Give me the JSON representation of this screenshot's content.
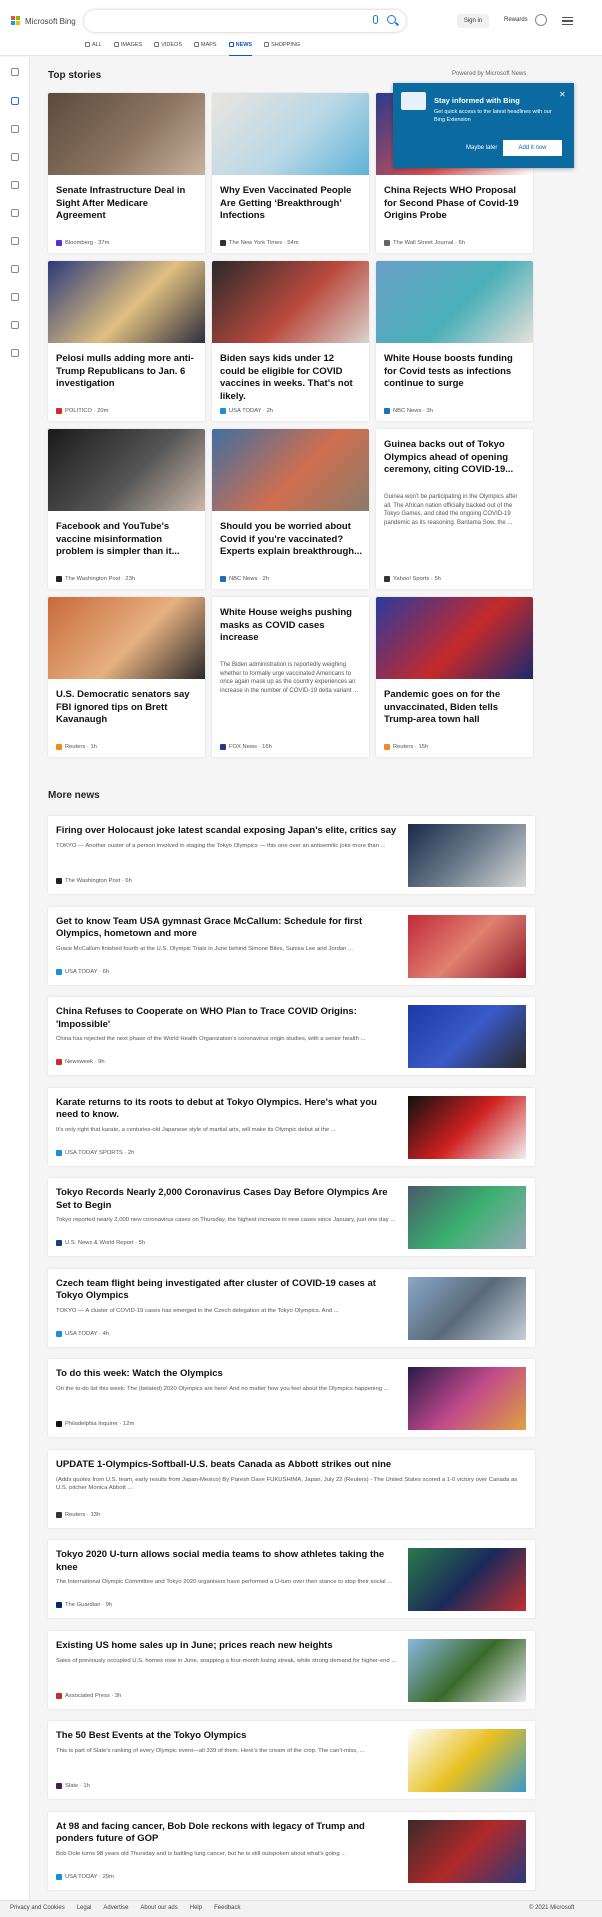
{
  "header": {
    "logo": "Microsoft Bing",
    "signin": "Sign in",
    "rewards": "Rewards"
  },
  "tabs": [
    {
      "label": "ALL"
    },
    {
      "label": "IMAGES"
    },
    {
      "label": "VIDEOS"
    },
    {
      "label": "MAPS"
    },
    {
      "label": "NEWS",
      "active": true
    },
    {
      "label": "SHOPPING"
    }
  ],
  "top_stories": {
    "title": "Top stories",
    "powered": "Powered by Microsoft News"
  },
  "popup": {
    "title": "Stay informed with Bing",
    "body": "Get quick access to the latest headlines with our Bing Extension",
    "later": "Maybe later",
    "install": "Add it now"
  },
  "cards": [
    {
      "title": "Senate Infrastructure Deal in Sight After Medicare Agreement",
      "source": "Bloomberg · 37m",
      "icon_color": "#5b2bd7",
      "img": [
        "#5a4a3c",
        "#8c7460",
        "#c8b39d"
      ]
    },
    {
      "title": "Why Even Vaccinated People Are Getting ‘Breakthrough’ Infections",
      "source": "The New York Times · 54m",
      "icon_color": "#333333",
      "img": [
        "#e9e5e0",
        "#b9d7e6",
        "#5eb2d6"
      ]
    },
    {
      "title": "China Rejects WHO Proposal for Second Phase of Covid-19 Origins Probe",
      "source": "The Wall Street Journal · 6h",
      "icon_color": "#666666",
      "img": [
        "#2a3a8c",
        "#d05050",
        "#ffffff"
      ]
    },
    {
      "title": "Pelosi mulls adding more anti-Trump Republicans to Jan. 6 investigation",
      "source": "POLITICO · 20m",
      "icon_color": "#d22b2b",
      "img": [
        "#2b3a7a",
        "#e0c080",
        "#2e2e3e"
      ]
    },
    {
      "title": "Biden says kids under 12 could be eligible for COVID vaccines in weeks. That's not likely.",
      "source": "USA TODAY · 2h",
      "icon_color": "#1a8fe0",
      "img": [
        "#2a2a2a",
        "#bb4a3f",
        "#d8d3cc"
      ]
    },
    {
      "title": "White House boosts funding for Covid tests as infections continue to surge",
      "source": "NBC News · 3h",
      "icon_color": "#1c6fbd",
      "img": [
        "#6aa0c8",
        "#4ab0b8",
        "#e8e0d8"
      ]
    },
    {
      "title": "Facebook and YouTube's vaccine misinformation problem is simpler than it...",
      "source": "The Washington Post · 23h",
      "icon_color": "#222222",
      "img": [
        "#1a1a1a",
        "#555555",
        "#cdb8a8"
      ]
    },
    {
      "title": "Should you be worried about Covid if you're vaccinated? Experts explain breakthrough...",
      "source": "NBC News · 2h",
      "icon_color": "#1c6fbd",
      "img": [
        "#3e6fa0",
        "#d06f50",
        "#8a7a6a"
      ]
    },
    {
      "title": "Guinea backs out of Tokyo Olympics ahead of opening ceremony, citing COVID-19...",
      "desc": "Guinea won't be participating in the Olympics after all. The African nation officially backed out of the Tokyo Games, and cited the ongoing COVID-19 pandemic as its reasoning.  Bantama Sow, the ...",
      "source": "Yahoo! Sports · 5h",
      "icon_color": "#333333"
    },
    {
      "title": "U.S. Democratic senators say FBI ignored tips on Brett Kavanaugh",
      "source": "Reuters · 1h",
      "icon_color": "#f08a24",
      "img": [
        "#c86a3a",
        "#e6b080",
        "#2a2a2a"
      ]
    },
    {
      "title": "White House weighs pushing masks as COVID cases increase",
      "desc": "The Biden administration is reportedly weighing whether to formally urge vaccinated Americans to once again mask up as the country experiences an increase in the number of COVID-19 delta variant ...",
      "source": "FOX News · 16h",
      "icon_color": "#223a8c"
    },
    {
      "title": "Pandemic goes on for the unvaccinated, Biden tells Trump-area town hall",
      "source": "Reuters · 15h",
      "icon_color": "#f08a24",
      "img": [
        "#2a3a9e",
        "#c42a2a",
        "#1a2a6e"
      ]
    }
  ],
  "more_news": {
    "title": "More news",
    "items": [
      {
        "title": "Firing over Holocaust joke latest scandal exposing Japan's elite, critics say",
        "desc": "TOKYO — Another ouster of a person involved in staging the Tokyo Olympics — this one over an antisemitic joke more than ...",
        "source": "The Washington Post · 6h",
        "icon_color": "#222222",
        "img": [
          "#1a2a4a",
          "#6a7a8a",
          "#d8d8d8"
        ]
      },
      {
        "title": "Get to know Team USA gymnast Grace McCallum: Schedule for first Olympics, hometown and more",
        "desc": "Grace McCallum finished fourth at the U.S. Olympic Trials in June behind Simone Biles, Sunisa Lee and Jordan ...",
        "source": "USA TODAY · 6h",
        "icon_color": "#1a8fe0",
        "img": [
          "#c02a3a",
          "#e08070",
          "#8a1a2a"
        ]
      },
      {
        "title": "China Refuses to Cooperate on WHO Plan to Trace COVID Origins: 'Impossible'",
        "desc": "China has rejected the next phase of the World Health Organization's coronavirus origin studies, with a senior health ...",
        "source": "Newsweek · 9h",
        "icon_color": "#d22b2b",
        "img": [
          "#1a3aa8",
          "#3a5ac8",
          "#2a2a2a"
        ]
      },
      {
        "title": "Karate returns to its roots to debut at Tokyo Olympics. Here's what you need to know.",
        "desc": "It's only right that karate, a centuries-old Japanese style of martial arts, will make its Olympic debut at the ...",
        "source": "USA TODAY SPORTS · 2h",
        "icon_color": "#1a8fe0",
        "img": [
          "#111111",
          "#d02020",
          "#f0f0f0"
        ]
      },
      {
        "title": "Tokyo Records Nearly 2,000 Coronavirus Cases Day Before Olympics Are Set to Begin",
        "desc": "Tokyo reported nearly 2,000 new coronavirus cases on Thursday, the highest increase in new cases since January, just one day ...",
        "source": "U.S. News & World Report · 5h",
        "icon_color": "#1a3a8c",
        "img": [
          "#4a5a6a",
          "#3ab070",
          "#9aa8b8"
        ]
      },
      {
        "title": "Czech team flight being investigated after cluster of COVID-19 cases at Tokyo Olympics",
        "desc": "TOKYO — A cluster of COVID-19 cases has emerged in the Czech delegation at the Tokyo Olympics. And ...",
        "source": "USA TODAY · 4h",
        "icon_color": "#1a8fe0",
        "img": [
          "#8aa8c8",
          "#5a6a7a",
          "#c8d0d8"
        ]
      },
      {
        "title": "To do this week: Watch the Olympics",
        "desc": "On the to-do list this week: The (belated) 2020 Olympics are here! And no matter how you feel about the Olympics happening ...",
        "source": "Philadelphia Inquirer · 12m",
        "icon_color": "#111111",
        "img": [
          "#2a1a4a",
          "#c04a8a",
          "#e0a040"
        ]
      },
      {
        "title": "UPDATE 1-Olympics-Softball-U.S. beats Canada as Abbott strikes out nine",
        "desc": "(Adds quotes from U.S. team, early results from Japan-Mexico) By Paresh Dave FUKUSHIMA, Japan, July 22 (Reuters) - The United States scored a 1-0 victory over Canada as U.S. pitcher Monica Abbott ...",
        "source": "Reuters · 13h",
        "icon_color": "#333333"
      },
      {
        "title": "Tokyo 2020 U-turn allows social media teams to show athletes taking the knee",
        "desc": "The International Olympic Committee and Tokyo 2020 organisers have performed a U-turn over their stance to stop their social ...",
        "source": "The Guardian · 9h",
        "icon_color": "#052962",
        "img": [
          "#2a7a4a",
          "#1a2a5a",
          "#c03030"
        ]
      },
      {
        "title": "Existing US home sales up in June; prices reach new heights",
        "desc": "Sales of previously occupied U.S. homes rose in June, snapping a four-month losing streak, while strong demand for higher-end ...",
        "source": "Associated Press · 3h",
        "icon_color": "#c42a2a",
        "img": [
          "#8ab8e0",
          "#3a6a2a",
          "#e8e8f0"
        ]
      },
      {
        "title": "The 50 Best Events at the Tokyo Olympics",
        "desc": "This is part of Slate's ranking of every Olympic event—all 339 of them. Here's the cream of the crop. The can't-miss, ...",
        "source": "Slate · 1h",
        "icon_color": "#4a1a5a",
        "img": [
          "#ffffff",
          "#e8c020",
          "#3a9ac8"
        ]
      },
      {
        "title": "At 98 and facing cancer, Bob Dole reckons with legacy of Trump and ponders future of GOP",
        "desc": "Bob Dole turns 98 years old Thursday and is battling lung cancer, but he is still outspoken about what's going ...",
        "source": "USA TODAY · 29m",
        "icon_color": "#1a8fe0",
        "img": [
          "#3a2a2a",
          "#b02a2a",
          "#2a3a7a"
        ]
      }
    ]
  },
  "footer": {
    "links": [
      "Privacy and Cookies",
      "Legal",
      "Advertise",
      "About our ads",
      "Help",
      "Feedback"
    ],
    "copyright": "© 2021 Microsoft"
  }
}
